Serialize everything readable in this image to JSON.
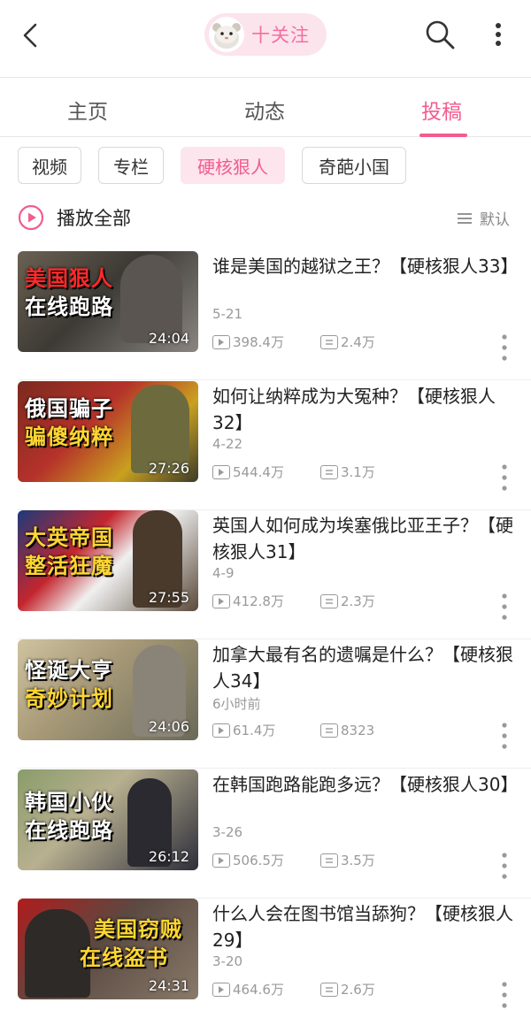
{
  "header": {
    "follow_label": "十关注",
    "icons": {
      "back": "back-arrow-icon",
      "search": "search-icon",
      "more": "more-vertical-icon"
    }
  },
  "tabs": [
    {
      "label": "主页"
    },
    {
      "label": "动态"
    },
    {
      "label": "投稿",
      "active": true
    }
  ],
  "chips": [
    {
      "label": "视频"
    },
    {
      "label": "专栏"
    },
    {
      "label": "硬核狠人",
      "active": true
    },
    {
      "label": "奇葩小国"
    }
  ],
  "playall": {
    "label": "播放全部",
    "sort_label": "默认"
  },
  "videos": [
    {
      "title": "谁是美国的越狱之王？【硬核狠人33】",
      "date": "5-21",
      "views": "398.4万",
      "comments": "2.4万",
      "duration": "24:04",
      "thumb_line1": "美国狠人",
      "thumb_line2": "在线跑路"
    },
    {
      "title": "如何让纳粹成为大冤种？【硬核狠人32】",
      "date": "4-22",
      "views": "544.4万",
      "comments": "3.1万",
      "duration": "27:26",
      "thumb_line1": "俄国骗子",
      "thumb_line2": "骗傻纳粹"
    },
    {
      "title": "英国人如何成为埃塞俄比亚王子？【硬核狠人31】",
      "date": "4-9",
      "views": "412.8万",
      "comments": "2.3万",
      "duration": "27:55",
      "thumb_line1": "大英帝国",
      "thumb_line2": "整活狂魔"
    },
    {
      "title": "加拿大最有名的遗嘱是什么？【硬核狠人34】",
      "date": "6小时前",
      "views": "61.4万",
      "comments": "8323",
      "duration": "24:06",
      "thumb_line1": "怪诞大亨",
      "thumb_line2": "奇妙计划"
    },
    {
      "title": "在韩国跑路能跑多远？【硬核狠人30】",
      "date": "3-26",
      "views": "506.5万",
      "comments": "3.5万",
      "duration": "26:12",
      "thumb_line1": "韩国小伙",
      "thumb_line2": "在线跑路"
    },
    {
      "title": "什么人会在图书馆当舔狗？【硬核狠人29】",
      "date": "3-20",
      "views": "464.6万",
      "comments": "2.6万",
      "duration": "24:31",
      "thumb_line1": "美国窃贼",
      "thumb_line2": "在线盗书"
    }
  ],
  "colors": {
    "accent": "#f25d8e",
    "chip_active_bg": "#fde5ee",
    "follow_bg": "#fce4ec"
  }
}
